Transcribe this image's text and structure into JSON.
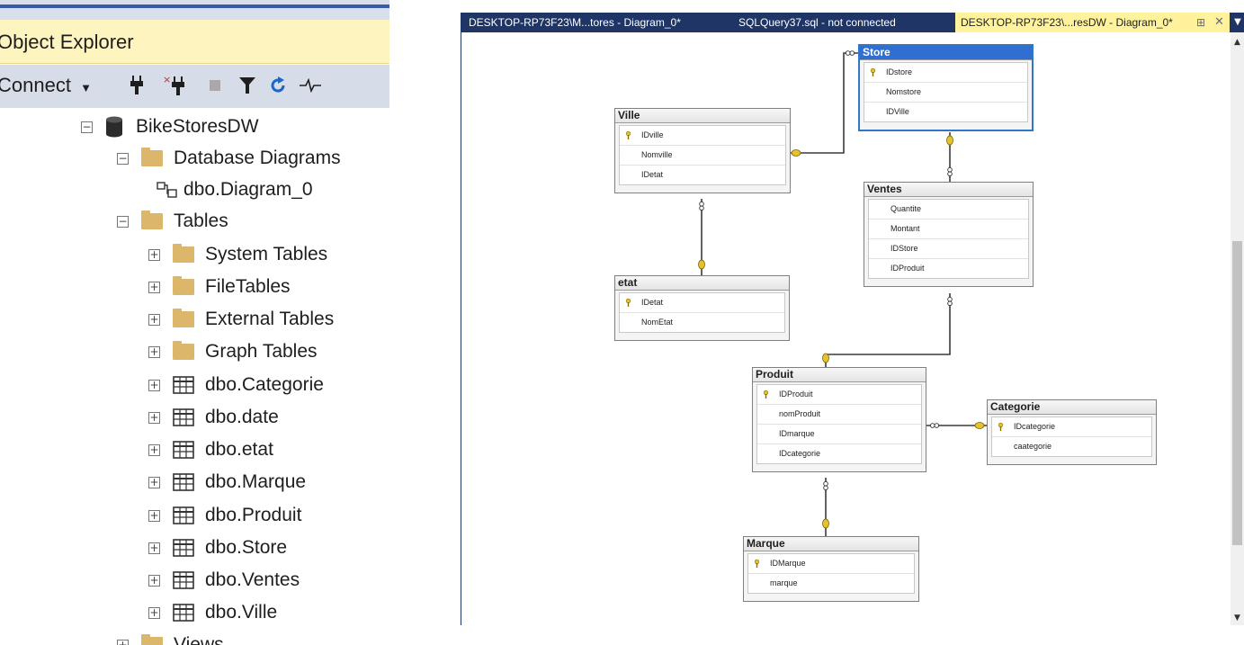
{
  "object_explorer": {
    "title": "Object Explorer",
    "connect_label": "Connect",
    "toolbar_icons": [
      "connect-plug-icon",
      "disconnect-icon",
      "stop-icon",
      "filter-icon",
      "refresh-icon",
      "activity-monitor-icon"
    ],
    "tree": [
      {
        "label": "BikeStoresDW",
        "icon": "database-icon",
        "expander": "minus"
      },
      {
        "label": "Database Diagrams",
        "icon": "folder-icon",
        "expander": "minus"
      },
      {
        "label": "dbo.Diagram_0",
        "icon": "diagram-icon",
        "expander": ""
      },
      {
        "label": "Tables",
        "icon": "folder-icon",
        "expander": "minus"
      },
      {
        "label": "System Tables",
        "icon": "folder-icon",
        "expander": "plus"
      },
      {
        "label": "FileTables",
        "icon": "folder-icon",
        "expander": "plus"
      },
      {
        "label": "External Tables",
        "icon": "folder-icon",
        "expander": "plus"
      },
      {
        "label": "Graph Tables",
        "icon": "folder-icon",
        "expander": "plus"
      },
      {
        "label": "dbo.Categorie",
        "icon": "table-icon",
        "expander": "plus"
      },
      {
        "label": "dbo.date",
        "icon": "table-icon",
        "expander": "plus"
      },
      {
        "label": "dbo.etat",
        "icon": "table-icon",
        "expander": "plus"
      },
      {
        "label": "dbo.Marque",
        "icon": "table-icon",
        "expander": "plus"
      },
      {
        "label": "dbo.Produit",
        "icon": "table-icon",
        "expander": "plus"
      },
      {
        "label": "dbo.Store",
        "icon": "table-icon",
        "expander": "plus"
      },
      {
        "label": "dbo.Ventes",
        "icon": "table-icon",
        "expander": "plus"
      },
      {
        "label": "dbo.Ville",
        "icon": "table-icon",
        "expander": "plus"
      },
      {
        "label": "Views",
        "icon": "folder-icon",
        "expander": "plus"
      }
    ]
  },
  "tabs": [
    {
      "label": "DESKTOP-RP73F23\\M...tores - Diagram_0*",
      "active": false
    },
    {
      "label": "SQLQuery37.sql - not connected",
      "active": false
    },
    {
      "label": "DESKTOP-RP73F23\\...resDW - Diagram_0*",
      "active": true
    }
  ],
  "tab_icons": [
    "pin-icon",
    "close-icon",
    "tab-list-icon"
  ],
  "diagram": {
    "tables": [
      {
        "name": "Store",
        "selected": true,
        "columns": [
          {
            "name": "IDstore",
            "pk": true
          },
          {
            "name": "Nomstore",
            "pk": false
          },
          {
            "name": "IDVille",
            "pk": false
          }
        ]
      },
      {
        "name": "Ville",
        "selected": false,
        "columns": [
          {
            "name": "IDville",
            "pk": true
          },
          {
            "name": "Nomville",
            "pk": false
          },
          {
            "name": "IDetat",
            "pk": false
          }
        ]
      },
      {
        "name": "Ventes",
        "selected": false,
        "columns": [
          {
            "name": "Quantite",
            "pk": false
          },
          {
            "name": "Montant",
            "pk": false
          },
          {
            "name": "IDStore",
            "pk": false
          },
          {
            "name": "IDProduit",
            "pk": false
          }
        ]
      },
      {
        "name": "etat",
        "selected": false,
        "columns": [
          {
            "name": "IDetat",
            "pk": true
          },
          {
            "name": "NomEtat",
            "pk": false
          }
        ]
      },
      {
        "name": "Produit",
        "selected": false,
        "columns": [
          {
            "name": "IDProduit",
            "pk": true
          },
          {
            "name": "nomProduit",
            "pk": false
          },
          {
            "name": "IDmarque",
            "pk": false
          },
          {
            "name": "IDcategorie",
            "pk": false
          }
        ]
      },
      {
        "name": "Categorie",
        "selected": false,
        "columns": [
          {
            "name": "IDcategorie",
            "pk": true
          },
          {
            "name": "caategorie",
            "pk": false
          }
        ]
      },
      {
        "name": "Marque",
        "selected": false,
        "columns": [
          {
            "name": "IDMarque",
            "pk": true
          },
          {
            "name": "marque",
            "pk": false
          }
        ]
      }
    ],
    "relationships": [
      {
        "from": "Ville",
        "to": "Store"
      },
      {
        "from": "Store",
        "to": "Ventes"
      },
      {
        "from": "Ville",
        "to": "etat"
      },
      {
        "from": "Produit",
        "to": "Ventes"
      },
      {
        "from": "Produit",
        "to": "Categorie"
      },
      {
        "from": "Produit",
        "to": "Marque"
      }
    ]
  },
  "colors": {
    "explorer_title_bg": "#fdf4bf",
    "tab_bar_bg": "#1f3566",
    "active_tab_bg": "#fff29d",
    "selected_table_header": "#2e6fd1",
    "key_icon": "#e3c22e"
  }
}
